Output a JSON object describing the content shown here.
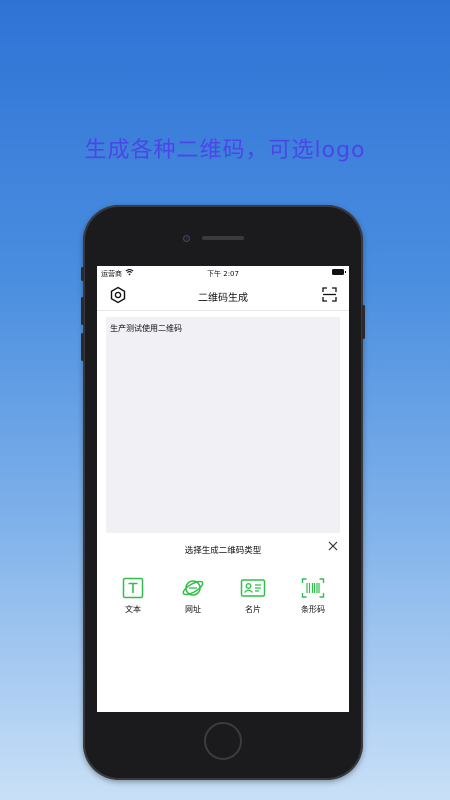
{
  "promo": {
    "headline": "生成各种二维码，可选logo"
  },
  "statusbar": {
    "carrier": "运营商",
    "time": "下午 2:07"
  },
  "navbar": {
    "title": "二维码生成",
    "left_icon": "settings-hexagon-icon",
    "right_icon": "scan-icon"
  },
  "editor": {
    "text": "生产测试使用二维码"
  },
  "picker": {
    "title": "选择生成二维码类型",
    "close_icon": "close-icon",
    "types": [
      {
        "label": "文本",
        "icon": "text-icon"
      },
      {
        "label": "网址",
        "icon": "globe-link-icon"
      },
      {
        "label": "名片",
        "icon": "business-card-icon"
      },
      {
        "label": "条形码",
        "icon": "barcode-icon"
      }
    ]
  },
  "colors": {
    "accent_green": "#2fbf4a",
    "headline": "#4c46e8"
  }
}
